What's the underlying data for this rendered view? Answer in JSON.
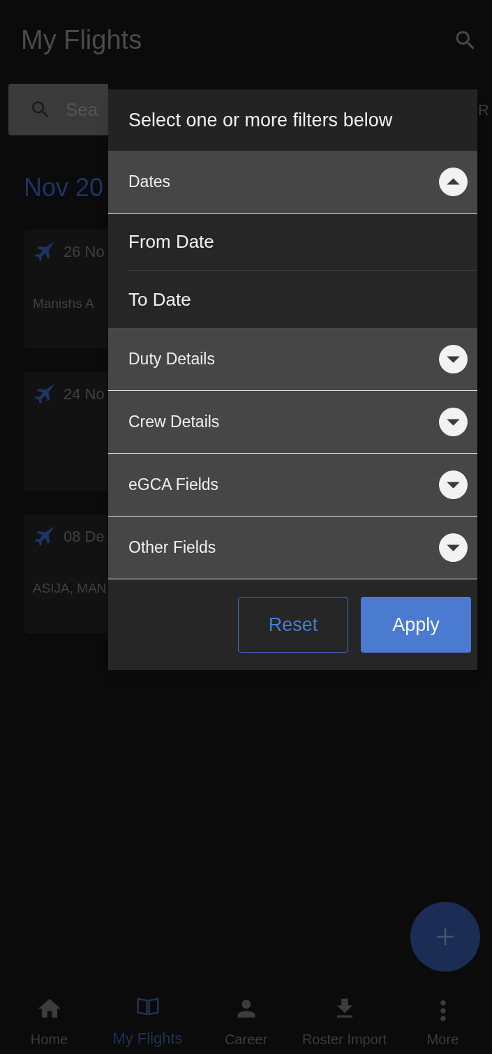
{
  "app_bar": {
    "title": "My Flights"
  },
  "search": {
    "placeholder": "Sea"
  },
  "filter_label": "R",
  "month_heading": "Nov 20",
  "flights": [
    {
      "date": "26 No",
      "detail": "Manishs A"
    },
    {
      "date": "24 No"
    },
    {
      "date": "08 De",
      "detail": "ASIJA, MAN"
    }
  ],
  "filter_popup": {
    "title": "Select one or more filters below",
    "sections": [
      {
        "label": "Dates",
        "expanded": true,
        "fields": [
          {
            "label": "From Date"
          },
          {
            "label": "To Date"
          }
        ]
      },
      {
        "label": "Duty Details",
        "expanded": false
      },
      {
        "label": "Crew Details",
        "expanded": false
      },
      {
        "label": "eGCA Fields",
        "expanded": false
      },
      {
        "label": "Other Fields",
        "expanded": false
      }
    ],
    "buttons": [
      {
        "label": "Reset",
        "kind": "outline"
      },
      {
        "label": "Apply",
        "kind": "filled"
      }
    ]
  },
  "nav": [
    {
      "label": "Home",
      "selected": false
    },
    {
      "label": "My Flights",
      "selected": true
    },
    {
      "label": "Career",
      "selected": false
    },
    {
      "label": "Roster Import",
      "selected": false
    },
    {
      "label": "More",
      "selected": false
    }
  ]
}
